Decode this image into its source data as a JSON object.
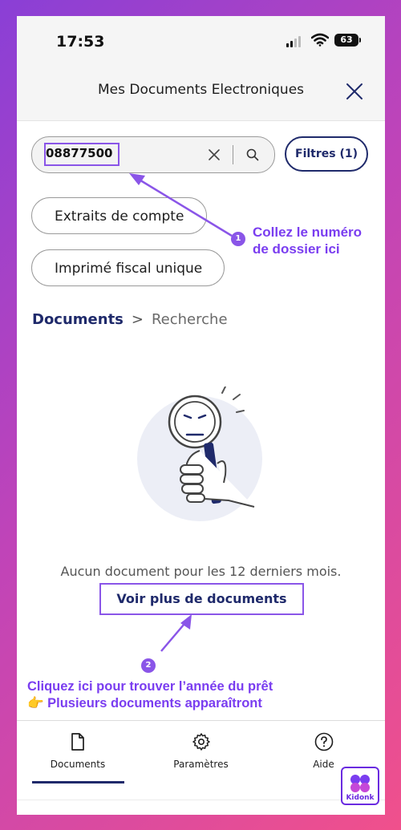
{
  "status_bar": {
    "time": "17:53",
    "battery": "63"
  },
  "header": {
    "title": "Mes Documents Electroniques"
  },
  "search": {
    "value": "08877500",
    "filter_label": "Filtres (1)"
  },
  "chips": [
    {
      "label": "Extraits de compte"
    },
    {
      "label": "Imprimé fiscal unique"
    }
  ],
  "breadcrumb": {
    "root": "Documents",
    "separator": ">",
    "current": "Recherche"
  },
  "empty_state": {
    "message": "Aucun document pour les 12 derniers mois.",
    "more_button": "Voir plus de documents"
  },
  "tabs": [
    {
      "label": "Documents",
      "icon": "document-icon"
    },
    {
      "label": "Paramètres",
      "icon": "gear-icon"
    },
    {
      "label": "Aide",
      "icon": "help-icon"
    }
  ],
  "annotations": [
    {
      "number": "1",
      "line1": "Collez le numéro",
      "line2": "de dossier ici"
    },
    {
      "number": "2",
      "line1": "Cliquez ici pour trouver l’année du prêt",
      "line2": "👉 Plusieurs documents apparaîtront"
    }
  ],
  "watermark": {
    "label": "Kidonk"
  },
  "colors": {
    "primary": "#1f2a6b",
    "annotation": "#8a55e8",
    "annotation_text": "#7a3df0"
  }
}
